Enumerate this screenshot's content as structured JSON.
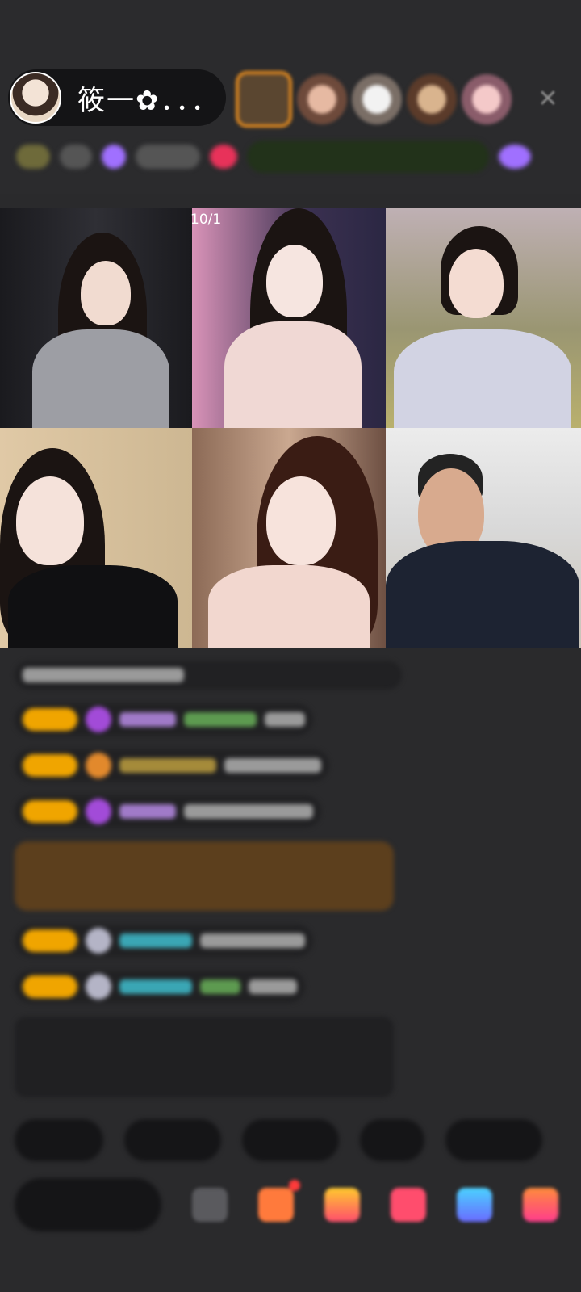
{
  "header": {
    "host_name": "筱一✿．．．",
    "close_icon": "close-icon"
  },
  "viewers": [
    "viewer-avatar-1",
    "viewer-avatar-2",
    "viewer-avatar-3",
    "viewer-avatar-4",
    "viewer-avatar-5",
    "viewer-avatar-6"
  ],
  "video_grid": {
    "page_indicator": "10/1",
    "streams": 6
  },
  "colors": {
    "background": "#2a2a2c",
    "badge": "#f0a500",
    "gift_banner": "#5c3f1d",
    "viewer_highlight": "#e38a1f"
  }
}
